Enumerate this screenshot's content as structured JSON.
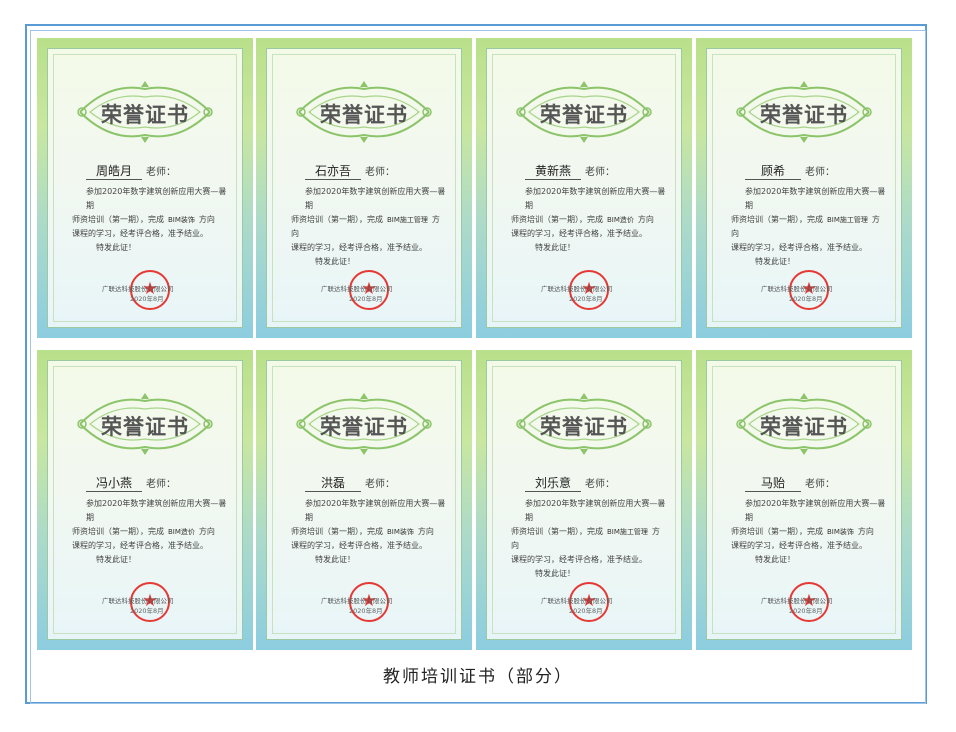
{
  "certificate_title": "荣誉证书",
  "teacher_suffix": "老师：",
  "line1": "参加2020年数字建筑创新应用大赛—暑期",
  "line2_prefix": "师资培训（第一期），完成",
  "line2_suffix": "方向",
  "line3": "课程的学习，经考评合格，准予结业。",
  "special": "特发此证！",
  "issuer": "广联达科技股份有限公司",
  "issue_date": "2020年8月",
  "caption": "教师培训证书（部分）",
  "certificates": [
    {
      "name": "周皓月",
      "course": "BIM装饰"
    },
    {
      "name": "石亦吾",
      "course": "BIM施工管理"
    },
    {
      "name": "黄新燕",
      "course": "BIM造价"
    },
    {
      "name": "顾希",
      "course": "BIM施工管理"
    },
    {
      "name": "冯小燕",
      "course": "BIM造价"
    },
    {
      "name": "洪磊",
      "course": "BIM装饰"
    },
    {
      "name": "刘乐意",
      "course": "BIM施工管理"
    },
    {
      "name": "马贻",
      "course": "BIM装饰"
    }
  ]
}
